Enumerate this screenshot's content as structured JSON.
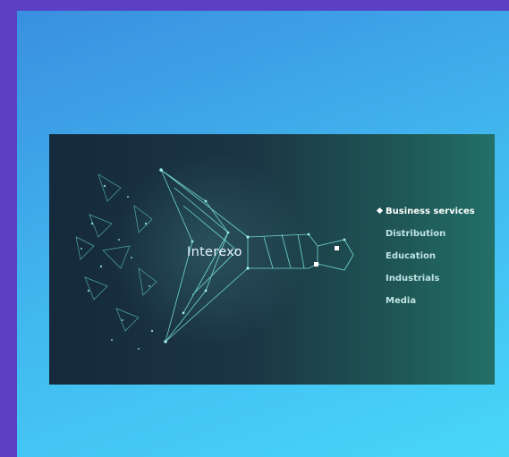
{
  "brand": {
    "name": "Interexo"
  },
  "menu": {
    "items": [
      {
        "label": "Business services",
        "active": true
      },
      {
        "label": "Distribution",
        "active": false
      },
      {
        "label": "Education",
        "active": false
      },
      {
        "label": "Industrials",
        "active": false
      },
      {
        "label": "Media",
        "active": false
      }
    ]
  },
  "colors": {
    "outer_bg": "#5b3fc4",
    "panel_gradient_start": "#3a8fe0",
    "panel_gradient_end": "#48d6f8",
    "card_bg": "#1b3544",
    "accent": "#6ff0e0",
    "menu_text": "#bfe3e3"
  },
  "icons": {
    "bullet": "diamond-bullet-icon",
    "illustration": "particle-funnel-illustration"
  }
}
